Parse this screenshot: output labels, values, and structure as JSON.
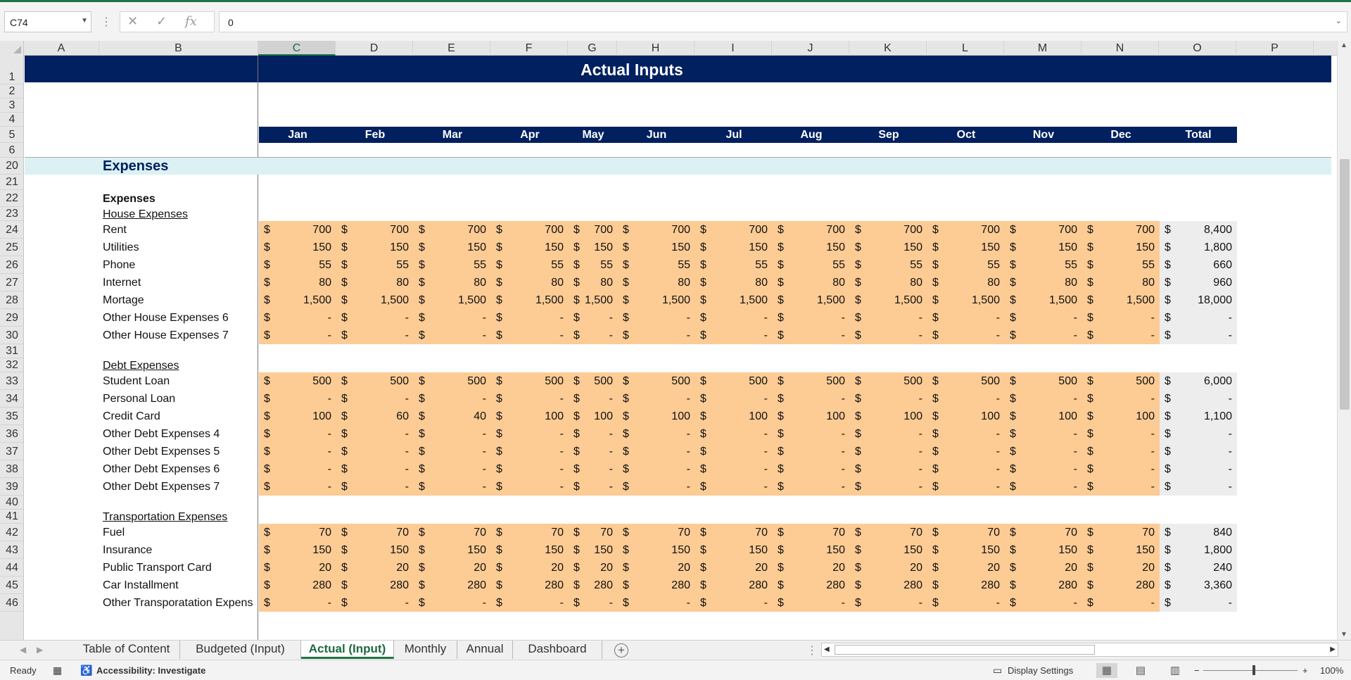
{
  "formula_bar": {
    "cell_ref": "C74",
    "formula": "0",
    "cancel_icon": "cancel-icon",
    "enter_icon": "enter-icon",
    "fx_icon": "fx-icon"
  },
  "columns": [
    "A",
    "B",
    "C",
    "D",
    "E",
    "F",
    "G",
    "H",
    "I",
    "J",
    "K",
    "L",
    "M",
    "N",
    "O",
    "P"
  ],
  "selected_column": "C",
  "rows": [
    "1",
    "2",
    "3",
    "4",
    "5",
    "6",
    "20",
    "21",
    "22",
    "23",
    "24",
    "25",
    "26",
    "27",
    "28",
    "29",
    "30",
    "31",
    "32",
    "33",
    "34",
    "35",
    "36",
    "37",
    "38",
    "39",
    "40",
    "41",
    "42",
    "43",
    "44",
    "45",
    "46"
  ],
  "sheet": {
    "title": "Actual Inputs",
    "months": [
      "Jan",
      "Feb",
      "Mar",
      "Apr",
      "May",
      "Jun",
      "Jul",
      "Aug",
      "Sep",
      "Oct",
      "Nov",
      "Dec"
    ],
    "total_label": "Total",
    "section": "Expenses",
    "expenses_label": "Expenses",
    "currency": "$",
    "groups": [
      {
        "name": "House Expenses",
        "items": [
          {
            "label": "Rent",
            "values": [
              "700",
              "700",
              "700",
              "700",
              "700",
              "700",
              "700",
              "700",
              "700",
              "700",
              "700",
              "700"
            ],
            "total": "8,400"
          },
          {
            "label": "Utilities",
            "values": [
              "150",
              "150",
              "150",
              "150",
              "150",
              "150",
              "150",
              "150",
              "150",
              "150",
              "150",
              "150"
            ],
            "total": "1,800"
          },
          {
            "label": "Phone",
            "values": [
              "55",
              "55",
              "55",
              "55",
              "55",
              "55",
              "55",
              "55",
              "55",
              "55",
              "55",
              "55"
            ],
            "total": "660"
          },
          {
            "label": "Internet",
            "values": [
              "80",
              "80",
              "80",
              "80",
              "80",
              "80",
              "80",
              "80",
              "80",
              "80",
              "80",
              "80"
            ],
            "total": "960"
          },
          {
            "label": "Mortage",
            "values": [
              "1,500",
              "1,500",
              "1,500",
              "1,500",
              "1,500",
              "1,500",
              "1,500",
              "1,500",
              "1,500",
              "1,500",
              "1,500",
              "1,500"
            ],
            "total": "18,000"
          },
          {
            "label": "Other House Expenses 6",
            "values": [
              "-",
              "-",
              "-",
              "-",
              "-",
              "-",
              "-",
              "-",
              "-",
              "-",
              "-",
              "-"
            ],
            "total": "-"
          },
          {
            "label": "Other House Expenses 7",
            "values": [
              "-",
              "-",
              "-",
              "-",
              "-",
              "-",
              "-",
              "-",
              "-",
              "-",
              "-",
              "-"
            ],
            "total": "-"
          }
        ]
      },
      {
        "name": "Debt Expenses",
        "items": [
          {
            "label": "Student Loan",
            "values": [
              "500",
              "500",
              "500",
              "500",
              "500",
              "500",
              "500",
              "500",
              "500",
              "500",
              "500",
              "500"
            ],
            "total": "6,000"
          },
          {
            "label": "Personal Loan",
            "values": [
              "-",
              "-",
              "-",
              "-",
              "-",
              "-",
              "-",
              "-",
              "-",
              "-",
              "-",
              "-"
            ],
            "total": "-"
          },
          {
            "label": "Credit Card",
            "values": [
              "100",
              "60",
              "40",
              "100",
              "100",
              "100",
              "100",
              "100",
              "100",
              "100",
              "100",
              "100"
            ],
            "total": "1,100"
          },
          {
            "label": "Other Debt Expenses 4",
            "values": [
              "-",
              "-",
              "-",
              "-",
              "-",
              "-",
              "-",
              "-",
              "-",
              "-",
              "-",
              "-"
            ],
            "total": "-"
          },
          {
            "label": "Other Debt Expenses 5",
            "values": [
              "-",
              "-",
              "-",
              "-",
              "-",
              "-",
              "-",
              "-",
              "-",
              "-",
              "-",
              "-"
            ],
            "total": "-"
          },
          {
            "label": "Other Debt Expenses 6",
            "values": [
              "-",
              "-",
              "-",
              "-",
              "-",
              "-",
              "-",
              "-",
              "-",
              "-",
              "-",
              "-"
            ],
            "total": "-"
          },
          {
            "label": "Other Debt Expenses 7",
            "values": [
              "-",
              "-",
              "-",
              "-",
              "-",
              "-",
              "-",
              "-",
              "-",
              "-",
              "-",
              "-"
            ],
            "total": "-"
          }
        ]
      },
      {
        "name": "Transportation Expenses",
        "items": [
          {
            "label": "Fuel",
            "values": [
              "70",
              "70",
              "70",
              "70",
              "70",
              "70",
              "70",
              "70",
              "70",
              "70",
              "70",
              "70"
            ],
            "total": "840"
          },
          {
            "label": "Insurance",
            "values": [
              "150",
              "150",
              "150",
              "150",
              "150",
              "150",
              "150",
              "150",
              "150",
              "150",
              "150",
              "150"
            ],
            "total": "1,800"
          },
          {
            "label": "Public Transport Card",
            "values": [
              "20",
              "20",
              "20",
              "20",
              "20",
              "20",
              "20",
              "20",
              "20",
              "20",
              "20",
              "20"
            ],
            "total": "240"
          },
          {
            "label": "Car Installment",
            "values": [
              "280",
              "280",
              "280",
              "280",
              "280",
              "280",
              "280",
              "280",
              "280",
              "280",
              "280",
              "280"
            ],
            "total": "3,360"
          },
          {
            "label": "Other Transporatation Expens",
            "values": [
              "-",
              "-",
              "-",
              "-",
              "-",
              "-",
              "-",
              "-",
              "-",
              "-",
              "-",
              "-"
            ],
            "total": "-"
          }
        ]
      }
    ]
  },
  "tabs": {
    "items": [
      "Table of Content",
      "Budgeted (Input)",
      "Actual (Input)",
      "Monthly",
      "Annual",
      "Dashboard"
    ],
    "active": "Actual (Input)",
    "add_icon": "plus-circle-icon"
  },
  "status_bar": {
    "ready": "Ready",
    "accessibility": "Accessibility: Investigate",
    "display_settings": "Display Settings",
    "zoom": "100%",
    "zoom_minus": "−",
    "zoom_plus": "+"
  },
  "colors": {
    "header_band": "#002060",
    "input_fill": "#fdcb94",
    "total_fill": "#ededed",
    "section_band": "#dbf1f4",
    "accent": "#217346"
  }
}
